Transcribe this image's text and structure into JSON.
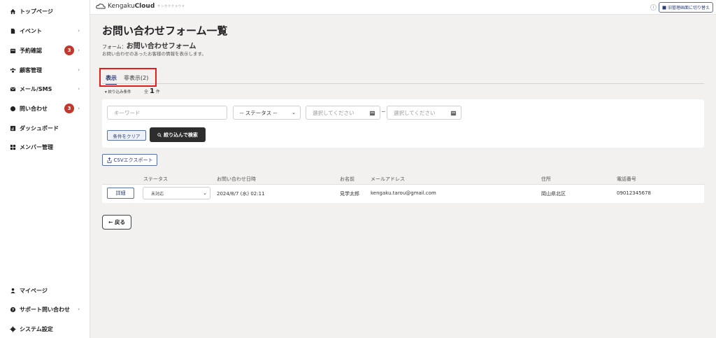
{
  "sidebar": {
    "items": [
      {
        "label": "トップページ",
        "icon": "home-icon",
        "chevron": false
      },
      {
        "label": "イベント",
        "icon": "document-icon",
        "chevron": true
      },
      {
        "label": "予約確認",
        "icon": "calendar-icon",
        "chevron": true,
        "badge": "3"
      },
      {
        "label": "顧客管理",
        "icon": "people-icon",
        "chevron": true
      },
      {
        "label": "メール/SMS",
        "icon": "mail-icon",
        "chevron": true
      },
      {
        "label": "問い合わせ",
        "icon": "chat-icon",
        "chevron": true,
        "badge": "3"
      },
      {
        "label": "ダッシュボード",
        "icon": "chart-icon",
        "chevron": false
      },
      {
        "label": "メンバー管理",
        "icon": "grid-icon",
        "chevron": false
      }
    ],
    "bottom": [
      {
        "label": "マイページ",
        "icon": "person-icon",
        "chevron": false
      },
      {
        "label": "サポート問い合わせ",
        "icon": "help-icon",
        "chevron": true
      },
      {
        "label": "システム設定",
        "icon": "gear-icon",
        "chevron": false
      }
    ]
  },
  "topbar": {
    "brand_light": "Kengaku",
    "brand_bold": "Cloud",
    "brand_sub": "ケンガククラウド",
    "info_icon": "i",
    "switch_label": "旧管理画面に切り替え"
  },
  "page": {
    "title": "お問い合わせフォーム一覧",
    "form_prefix": "フォーム：",
    "form_name": "お問い合わせフォーム",
    "description": "お問い合わせのあったお客様の情報を表示します。"
  },
  "tabs": {
    "shown": "表示",
    "hidden": "非表示(2)"
  },
  "filter": {
    "toggle_label": "▾ 絞り込み条件",
    "count_prefix": "全",
    "count": "1",
    "count_suffix": "件",
    "keyword_placeholder": "キーワード",
    "status_value": "-- ステータス --",
    "date_start_placeholder": "選択してください",
    "date_end_placeholder": "選択してください",
    "tilde": "~",
    "clear_label": "条件をクリア",
    "search_label": "絞り込んで検索"
  },
  "csv_label": "CSVエクスポート",
  "table": {
    "headers": {
      "status": "ステータス",
      "date": "お問い合わせ日時",
      "name": "お名前",
      "email": "メールアドレス",
      "address": "住所",
      "phone": "電話番号"
    },
    "rows": [
      {
        "detail_label": "詳細",
        "status": "未対応",
        "date": "2024/8/7 (水) 02:11",
        "name": "見学太郎",
        "email": "kengaku.tarou@gmail.com",
        "address": "岡山県北区",
        "phone": "09012345678"
      }
    ]
  },
  "back_label": "← 戻る",
  "colors": {
    "accent": "#1b2c60",
    "badge": "#c0392b",
    "highlight": "#e31c1c",
    "background": "#f2f1ef"
  }
}
